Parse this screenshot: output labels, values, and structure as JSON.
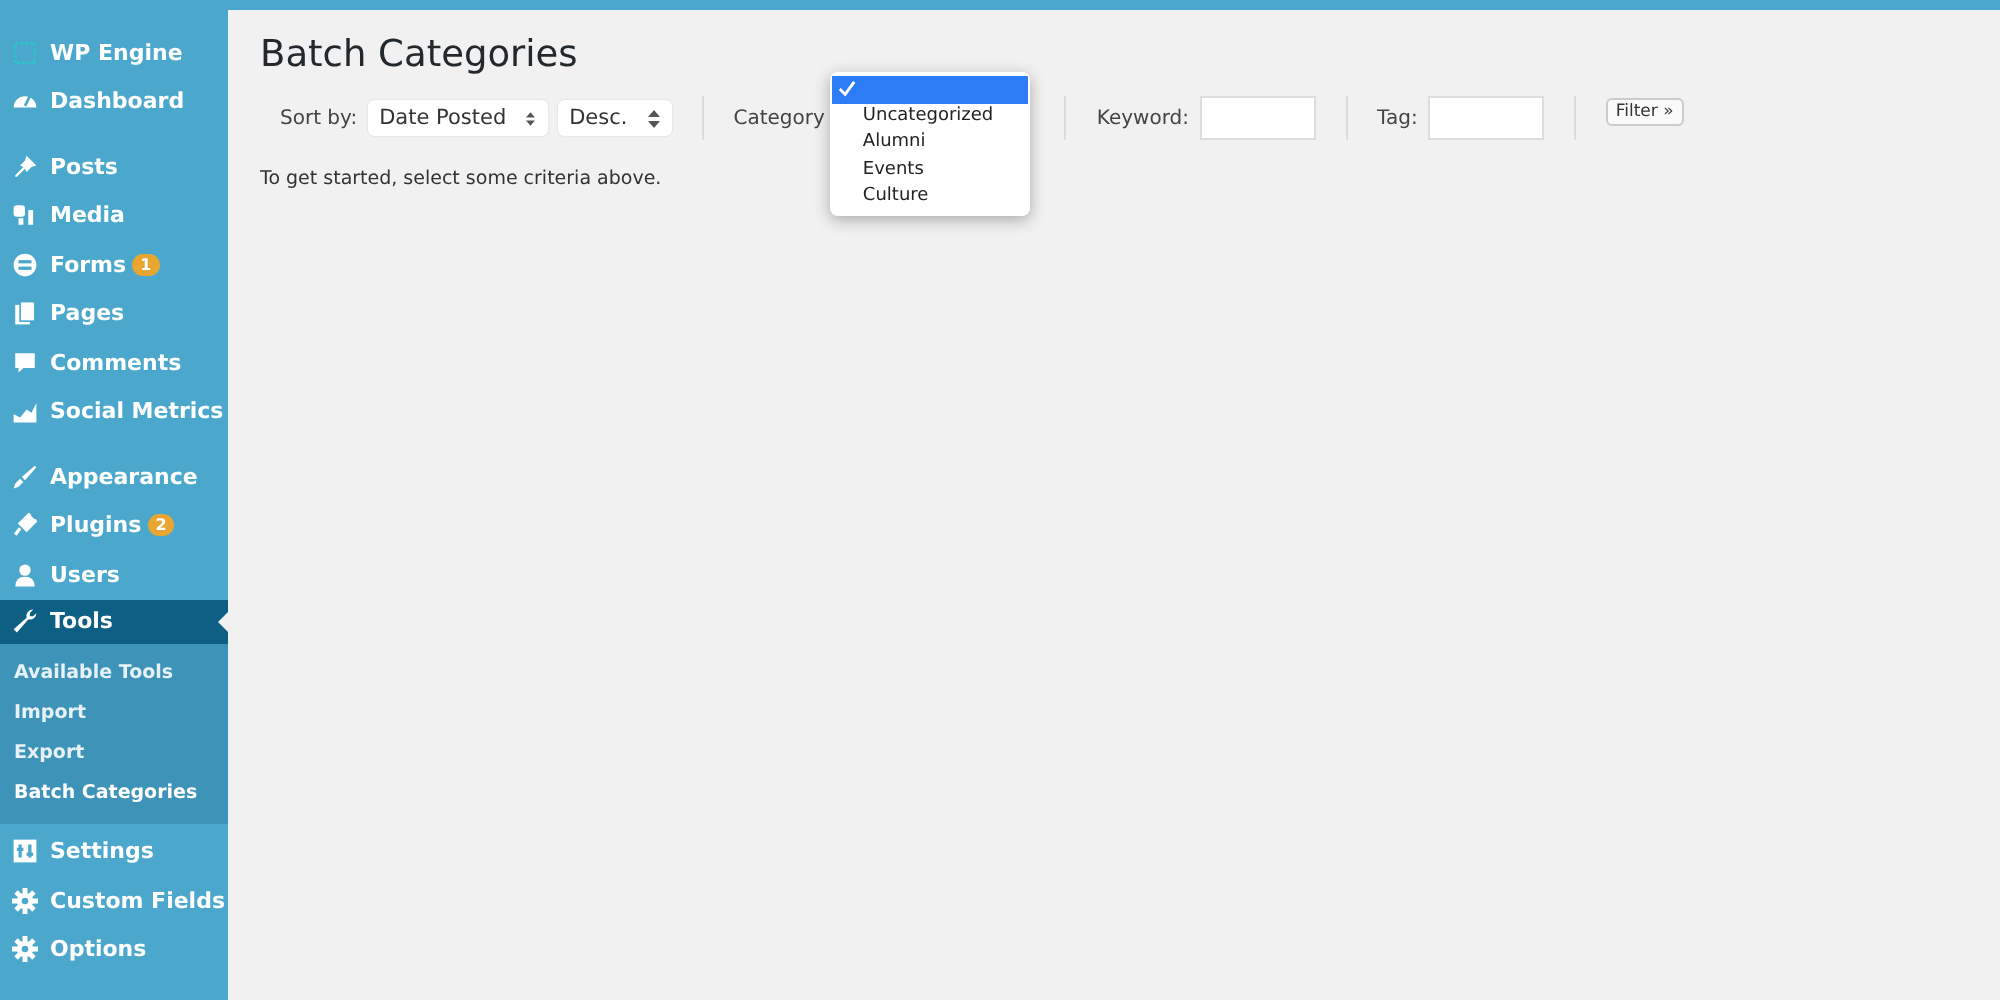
{
  "sidebar": {
    "groups": [
      [
        {
          "label": "WP Engine",
          "selected": false
        },
        {
          "label": "Dashboard",
          "selected": false
        }
      ],
      [
        {
          "label": "Posts",
          "selected": false
        },
        {
          "label": "Media",
          "selected": false
        },
        {
          "label": "Forms",
          "selected": false,
          "badge": "1"
        },
        {
          "label": "Pages",
          "selected": false
        },
        {
          "label": "Comments",
          "selected": false
        },
        {
          "label": "Social Metrics",
          "selected": false
        }
      ],
      [
        {
          "label": "Appearance",
          "selected": false
        },
        {
          "label": "Plugins",
          "selected": false,
          "badge": "2"
        },
        {
          "label": "Users",
          "selected": false
        },
        {
          "label": "Tools",
          "selected": true,
          "children": [
            {
              "label": "Available Tools",
              "selected": false
            },
            {
              "label": "Import",
              "selected": false
            },
            {
              "label": "Export",
              "selected": false
            },
            {
              "label": "Batch Categories",
              "selected": true
            }
          ]
        },
        {
          "label": "Settings",
          "selected": false
        },
        {
          "label": "Custom Fields",
          "selected": false
        },
        {
          "label": "Options",
          "selected": false
        }
      ]
    ]
  },
  "page": {
    "title": "Batch Categories",
    "filters": {
      "sort_label": "Sort by:",
      "sort_value": "Date Posted",
      "order_value": "Desc.",
      "category_label": "Category",
      "category_options": [
        {
          "selected": true
        },
        {
          "label": "Uncategorized",
          "selected": false
        },
        {
          "label": "Alumni",
          "selected": false
        },
        {
          "label": "Events",
          "selected": false
        },
        {
          "label": "Culture",
          "selected": false
        }
      ],
      "keyword_label": "Keyword:",
      "tag_label": "Tag:",
      "filter_button": "Filter »"
    },
    "message": "To get started, select some criteria above."
  }
}
